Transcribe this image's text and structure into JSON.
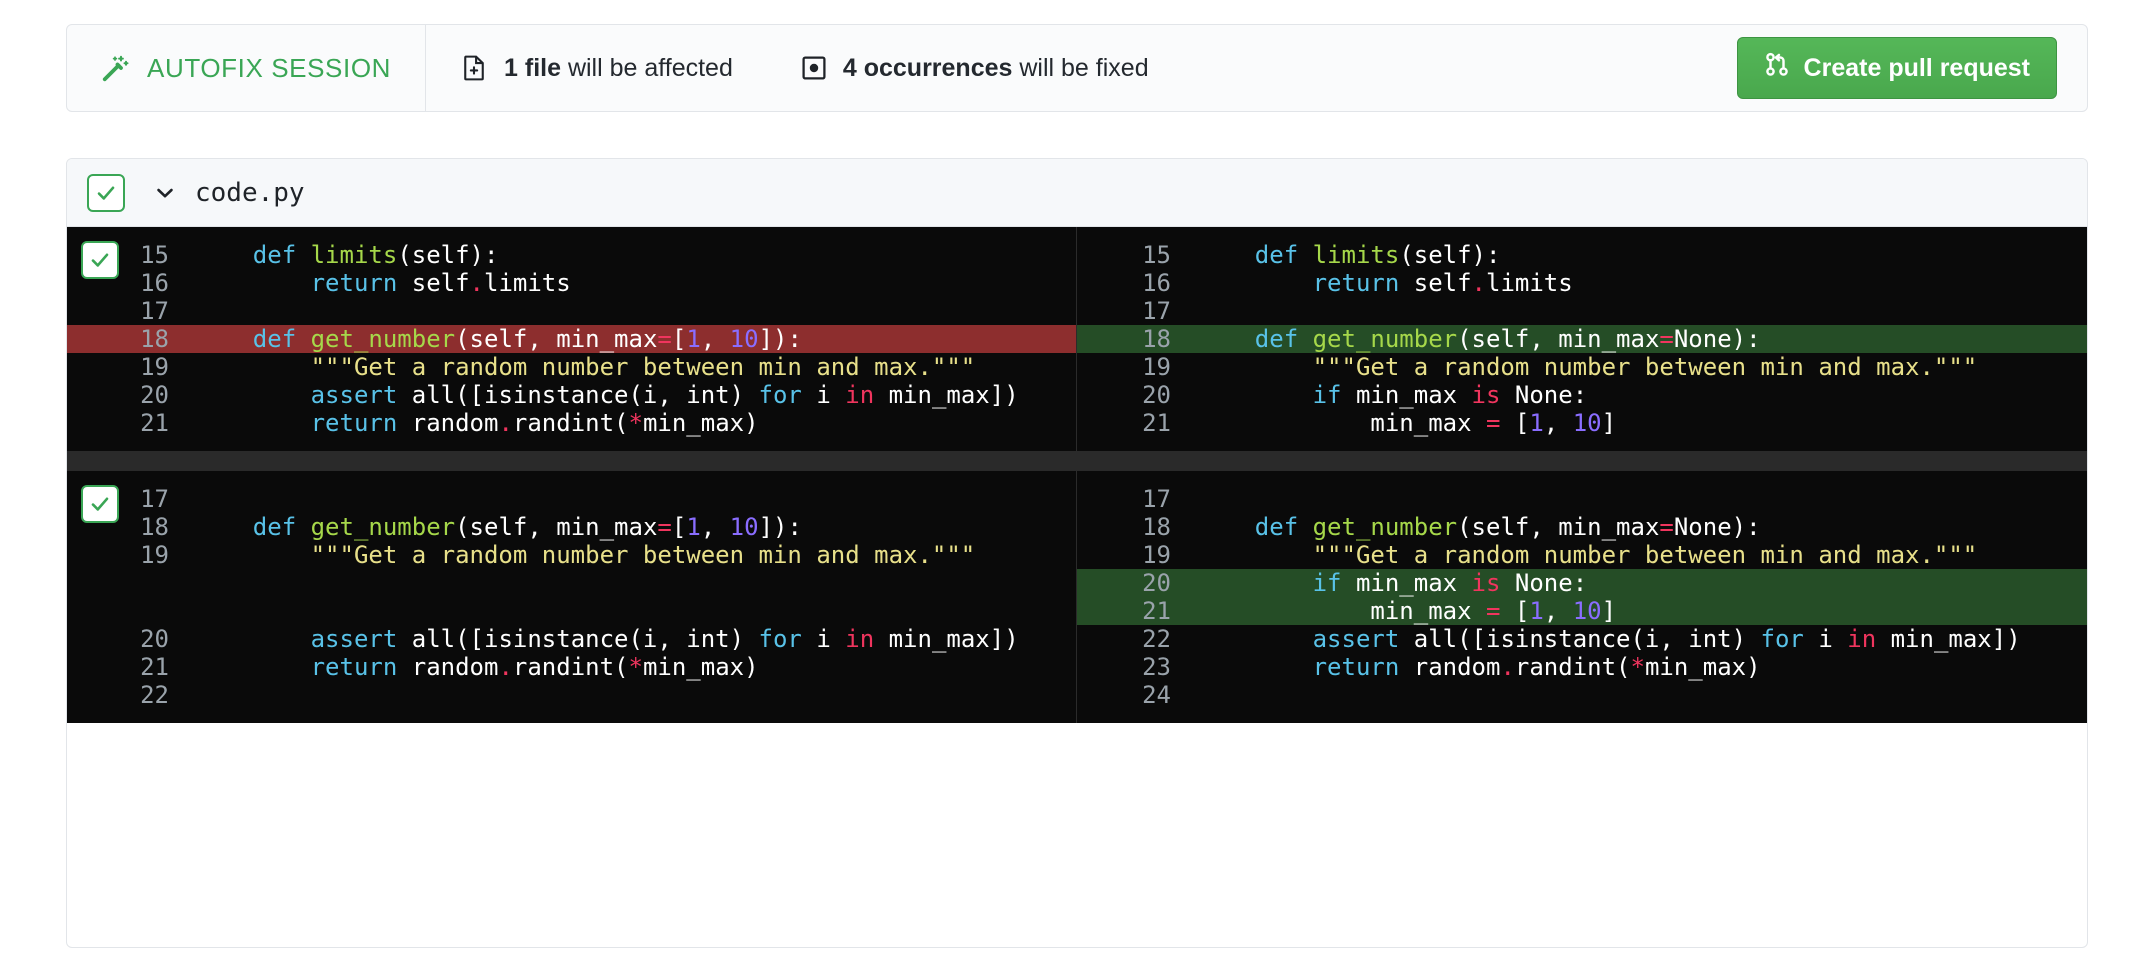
{
  "summary": {
    "autofix_label": "AUTOFIX SESSION",
    "wand_icon": "magic-wand-icon",
    "files_count": "1 file",
    "files_suffix": " will be affected",
    "files_icon": "file-diff-icon",
    "occurrences_count": "4 occurrences",
    "occurrences_suffix": " will be fixed",
    "occurrences_icon": "issue-dot-icon",
    "create_pr_label": "Create pull request",
    "create_pr_icon": "git-pull-request-icon",
    "accent_green": "#3aa655",
    "button_green": "#4da851"
  },
  "file": {
    "name": "code.py",
    "checkbox_checked": true,
    "caret_icon": "chevron-down-icon",
    "check_icon": "check-icon"
  },
  "diff": {
    "theme": {
      "background": "#0a0a0a",
      "deleted_bg": "#8d2e2e",
      "added_bg": "#254d26",
      "line_number": "#9aa3ab",
      "keyword": "#59c2e8",
      "operator": "#f0355e",
      "function": "#a6d84a",
      "number": "#8a6dff",
      "string": "#e8e08a",
      "plain": "#ffffff"
    },
    "hunks": [
      {
        "checkbox_checked": true,
        "left": [
          {
            "num": "15",
            "type": "context",
            "tokens": [
              {
                "t": "    ",
                "c": "pl"
              },
              {
                "t": "def",
                "c": "kw"
              },
              {
                "t": " ",
                "c": "pl"
              },
              {
                "t": "limits",
                "c": "fn"
              },
              {
                "t": "(self):",
                "c": "pl"
              }
            ]
          },
          {
            "num": "16",
            "type": "context",
            "tokens": [
              {
                "t": "        ",
                "c": "pl"
              },
              {
                "t": "return",
                "c": "kw"
              },
              {
                "t": " self",
                "c": "pl"
              },
              {
                "t": ".",
                "c": "op"
              },
              {
                "t": "limits",
                "c": "pl"
              }
            ]
          },
          {
            "num": "17",
            "type": "context",
            "tokens": []
          },
          {
            "num": "18",
            "type": "deleted",
            "tokens": [
              {
                "t": "    ",
                "c": "pl"
              },
              {
                "t": "def",
                "c": "kw"
              },
              {
                "t": " ",
                "c": "pl"
              },
              {
                "t": "get_number",
                "c": "fn"
              },
              {
                "t": "(self, min_max",
                "c": "pl"
              },
              {
                "t": "=",
                "c": "op"
              },
              {
                "t": "[",
                "c": "pl"
              },
              {
                "t": "1",
                "c": "num"
              },
              {
                "t": ", ",
                "c": "pl"
              },
              {
                "t": "10",
                "c": "num"
              },
              {
                "t": "]):",
                "c": "pl"
              }
            ]
          },
          {
            "num": "19",
            "type": "context",
            "tokens": [
              {
                "t": "        ",
                "c": "pl"
              },
              {
                "t": "\"\"\"Get a random number between min and max.\"\"\"",
                "c": "str"
              }
            ]
          },
          {
            "num": "20",
            "type": "context",
            "tokens": [
              {
                "t": "        ",
                "c": "pl"
              },
              {
                "t": "assert",
                "c": "kw"
              },
              {
                "t": " all([isinstance(i, int) ",
                "c": "pl"
              },
              {
                "t": "for",
                "c": "kw"
              },
              {
                "t": " i ",
                "c": "pl"
              },
              {
                "t": "in",
                "c": "op"
              },
              {
                "t": " min_max])",
                "c": "pl"
              }
            ]
          },
          {
            "num": "21",
            "type": "context",
            "tokens": [
              {
                "t": "        ",
                "c": "pl"
              },
              {
                "t": "return",
                "c": "kw"
              },
              {
                "t": " random",
                "c": "pl"
              },
              {
                "t": ".",
                "c": "op"
              },
              {
                "t": "randint(",
                "c": "pl"
              },
              {
                "t": "*",
                "c": "op"
              },
              {
                "t": "min_max)",
                "c": "pl"
              }
            ]
          }
        ],
        "right": [
          {
            "num": "15",
            "type": "context",
            "tokens": [
              {
                "t": "    ",
                "c": "pl"
              },
              {
                "t": "def",
                "c": "kw"
              },
              {
                "t": " ",
                "c": "pl"
              },
              {
                "t": "limits",
                "c": "fn"
              },
              {
                "t": "(self):",
                "c": "pl"
              }
            ]
          },
          {
            "num": "16",
            "type": "context",
            "tokens": [
              {
                "t": "        ",
                "c": "pl"
              },
              {
                "t": "return",
                "c": "kw"
              },
              {
                "t": " self",
                "c": "pl"
              },
              {
                "t": ".",
                "c": "op"
              },
              {
                "t": "limits",
                "c": "pl"
              }
            ]
          },
          {
            "num": "17",
            "type": "context",
            "tokens": []
          },
          {
            "num": "18",
            "type": "added",
            "tokens": [
              {
                "t": "    ",
                "c": "pl"
              },
              {
                "t": "def",
                "c": "kw"
              },
              {
                "t": " ",
                "c": "pl"
              },
              {
                "t": "get_number",
                "c": "fn"
              },
              {
                "t": "(self, min_max",
                "c": "pl"
              },
              {
                "t": "=",
                "c": "op"
              },
              {
                "t": "None):",
                "c": "pl"
              }
            ]
          },
          {
            "num": "19",
            "type": "context",
            "tokens": [
              {
                "t": "        ",
                "c": "pl"
              },
              {
                "t": "\"\"\"Get a random number between min and max.\"\"\"",
                "c": "str"
              }
            ]
          },
          {
            "num": "20",
            "type": "context",
            "tokens": [
              {
                "t": "        ",
                "c": "pl"
              },
              {
                "t": "if",
                "c": "kw"
              },
              {
                "t": " min_max ",
                "c": "pl"
              },
              {
                "t": "is",
                "c": "op"
              },
              {
                "t": " None:",
                "c": "pl"
              }
            ]
          },
          {
            "num": "21",
            "type": "context",
            "tokens": [
              {
                "t": "            ",
                "c": "pl"
              },
              {
                "t": "min_max ",
                "c": "pl"
              },
              {
                "t": "=",
                "c": "op"
              },
              {
                "t": " [",
                "c": "pl"
              },
              {
                "t": "1",
                "c": "num"
              },
              {
                "t": ", ",
                "c": "pl"
              },
              {
                "t": "10",
                "c": "num"
              },
              {
                "t": "]",
                "c": "pl"
              }
            ]
          }
        ]
      },
      {
        "checkbox_checked": true,
        "left": [
          {
            "num": "17",
            "type": "context",
            "tokens": []
          },
          {
            "num": "18",
            "type": "context",
            "tokens": [
              {
                "t": "    ",
                "c": "pl"
              },
              {
                "t": "def",
                "c": "kw"
              },
              {
                "t": " ",
                "c": "pl"
              },
              {
                "t": "get_number",
                "c": "fn"
              },
              {
                "t": "(self, min_max",
                "c": "pl"
              },
              {
                "t": "=",
                "c": "op"
              },
              {
                "t": "[",
                "c": "pl"
              },
              {
                "t": "1",
                "c": "num"
              },
              {
                "t": ", ",
                "c": "pl"
              },
              {
                "t": "10",
                "c": "num"
              },
              {
                "t": "]):",
                "c": "pl"
              }
            ]
          },
          {
            "num": "19",
            "type": "context",
            "tokens": [
              {
                "t": "        ",
                "c": "pl"
              },
              {
                "t": "\"\"\"Get a random number between min and max.\"\"\"",
                "c": "str"
              }
            ]
          },
          {
            "num": "",
            "type": "filler",
            "tokens": []
          },
          {
            "num": "",
            "type": "filler",
            "tokens": []
          },
          {
            "num": "20",
            "type": "context",
            "tokens": [
              {
                "t": "        ",
                "c": "pl"
              },
              {
                "t": "assert",
                "c": "kw"
              },
              {
                "t": " all([isinstance(i, int) ",
                "c": "pl"
              },
              {
                "t": "for",
                "c": "kw"
              },
              {
                "t": " i ",
                "c": "pl"
              },
              {
                "t": "in",
                "c": "op"
              },
              {
                "t": " min_max])",
                "c": "pl"
              }
            ]
          },
          {
            "num": "21",
            "type": "context",
            "tokens": [
              {
                "t": "        ",
                "c": "pl"
              },
              {
                "t": "return",
                "c": "kw"
              },
              {
                "t": " random",
                "c": "pl"
              },
              {
                "t": ".",
                "c": "op"
              },
              {
                "t": "randint(",
                "c": "pl"
              },
              {
                "t": "*",
                "c": "op"
              },
              {
                "t": "min_max)",
                "c": "pl"
              }
            ]
          },
          {
            "num": "22",
            "type": "context",
            "tokens": []
          }
        ],
        "right": [
          {
            "num": "17",
            "type": "context",
            "tokens": []
          },
          {
            "num": "18",
            "type": "context",
            "tokens": [
              {
                "t": "    ",
                "c": "pl"
              },
              {
                "t": "def",
                "c": "kw"
              },
              {
                "t": " ",
                "c": "pl"
              },
              {
                "t": "get_number",
                "c": "fn"
              },
              {
                "t": "(self, min_max",
                "c": "pl"
              },
              {
                "t": "=",
                "c": "op"
              },
              {
                "t": "None):",
                "c": "pl"
              }
            ]
          },
          {
            "num": "19",
            "type": "context",
            "tokens": [
              {
                "t": "        ",
                "c": "pl"
              },
              {
                "t": "\"\"\"Get a random number between min and max.\"\"\"",
                "c": "str"
              }
            ]
          },
          {
            "num": "20",
            "type": "added",
            "tokens": [
              {
                "t": "        ",
                "c": "pl"
              },
              {
                "t": "if",
                "c": "kw"
              },
              {
                "t": " min_max ",
                "c": "pl"
              },
              {
                "t": "is",
                "c": "op"
              },
              {
                "t": " None:",
                "c": "pl"
              }
            ]
          },
          {
            "num": "21",
            "type": "added",
            "tokens": [
              {
                "t": "            ",
                "c": "pl"
              },
              {
                "t": "min_max ",
                "c": "pl"
              },
              {
                "t": "=",
                "c": "op"
              },
              {
                "t": " [",
                "c": "pl"
              },
              {
                "t": "1",
                "c": "num"
              },
              {
                "t": ", ",
                "c": "pl"
              },
              {
                "t": "10",
                "c": "num"
              },
              {
                "t": "]",
                "c": "pl"
              }
            ]
          },
          {
            "num": "22",
            "type": "context",
            "tokens": [
              {
                "t": "        ",
                "c": "pl"
              },
              {
                "t": "assert",
                "c": "kw"
              },
              {
                "t": " all([isinstance(i, int) ",
                "c": "pl"
              },
              {
                "t": "for",
                "c": "kw"
              },
              {
                "t": " i ",
                "c": "pl"
              },
              {
                "t": "in",
                "c": "op"
              },
              {
                "t": " min_max])",
                "c": "pl"
              }
            ]
          },
          {
            "num": "23",
            "type": "context",
            "tokens": [
              {
                "t": "        ",
                "c": "pl"
              },
              {
                "t": "return",
                "c": "kw"
              },
              {
                "t": " random",
                "c": "pl"
              },
              {
                "t": ".",
                "c": "op"
              },
              {
                "t": "randint(",
                "c": "pl"
              },
              {
                "t": "*",
                "c": "op"
              },
              {
                "t": "min_max)",
                "c": "pl"
              }
            ]
          },
          {
            "num": "24",
            "type": "context",
            "tokens": []
          }
        ]
      }
    ]
  }
}
